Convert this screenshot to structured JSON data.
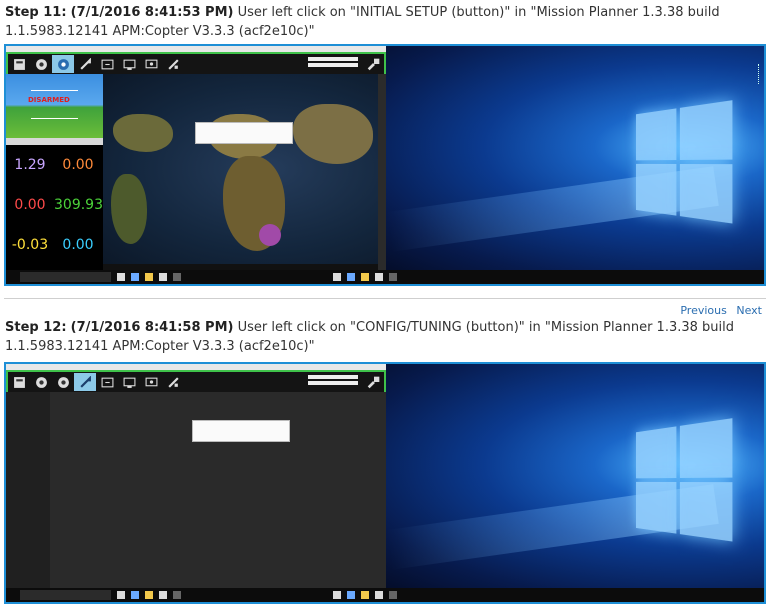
{
  "step11": {
    "label": "Step 11:",
    "timestamp": "(7/1/2016 8:41:53 PM)",
    "description": "User left click on \"INITIAL SETUP (button)\" in \"Mission Planner 1.3.38 build 1.1.5983.12141 APM:Copter V3.3.3 (acf2e10c)\"",
    "hud_status": "DISARMED",
    "quick": [
      {
        "value": "1.29",
        "color": "#c9a6ff"
      },
      {
        "value": "0.00",
        "color": "#ff8a3a"
      },
      {
        "value": "0.00",
        "color": "#ff4a4a"
      },
      {
        "value": "309.93",
        "color": "#4cd33a"
      },
      {
        "value": "-0.03",
        "color": "#ffe03a"
      },
      {
        "value": "0.00",
        "color": "#3acfff"
      }
    ]
  },
  "navigation": {
    "previous": "Previous",
    "next": "Next"
  },
  "step12": {
    "label": "Step 12:",
    "timestamp": "(7/1/2016 8:41:58 PM)",
    "description": "User left click on \"CONFIG/TUNING (button)\" in \"Mission Planner 1.3.38 build 1.1.5983.12141 APM:Copter V3.3.3 (acf2e10c)\""
  },
  "colors": {
    "highlight": "#3fc24a",
    "frame": "#1e8fd6",
    "link": "#2a6db0"
  }
}
